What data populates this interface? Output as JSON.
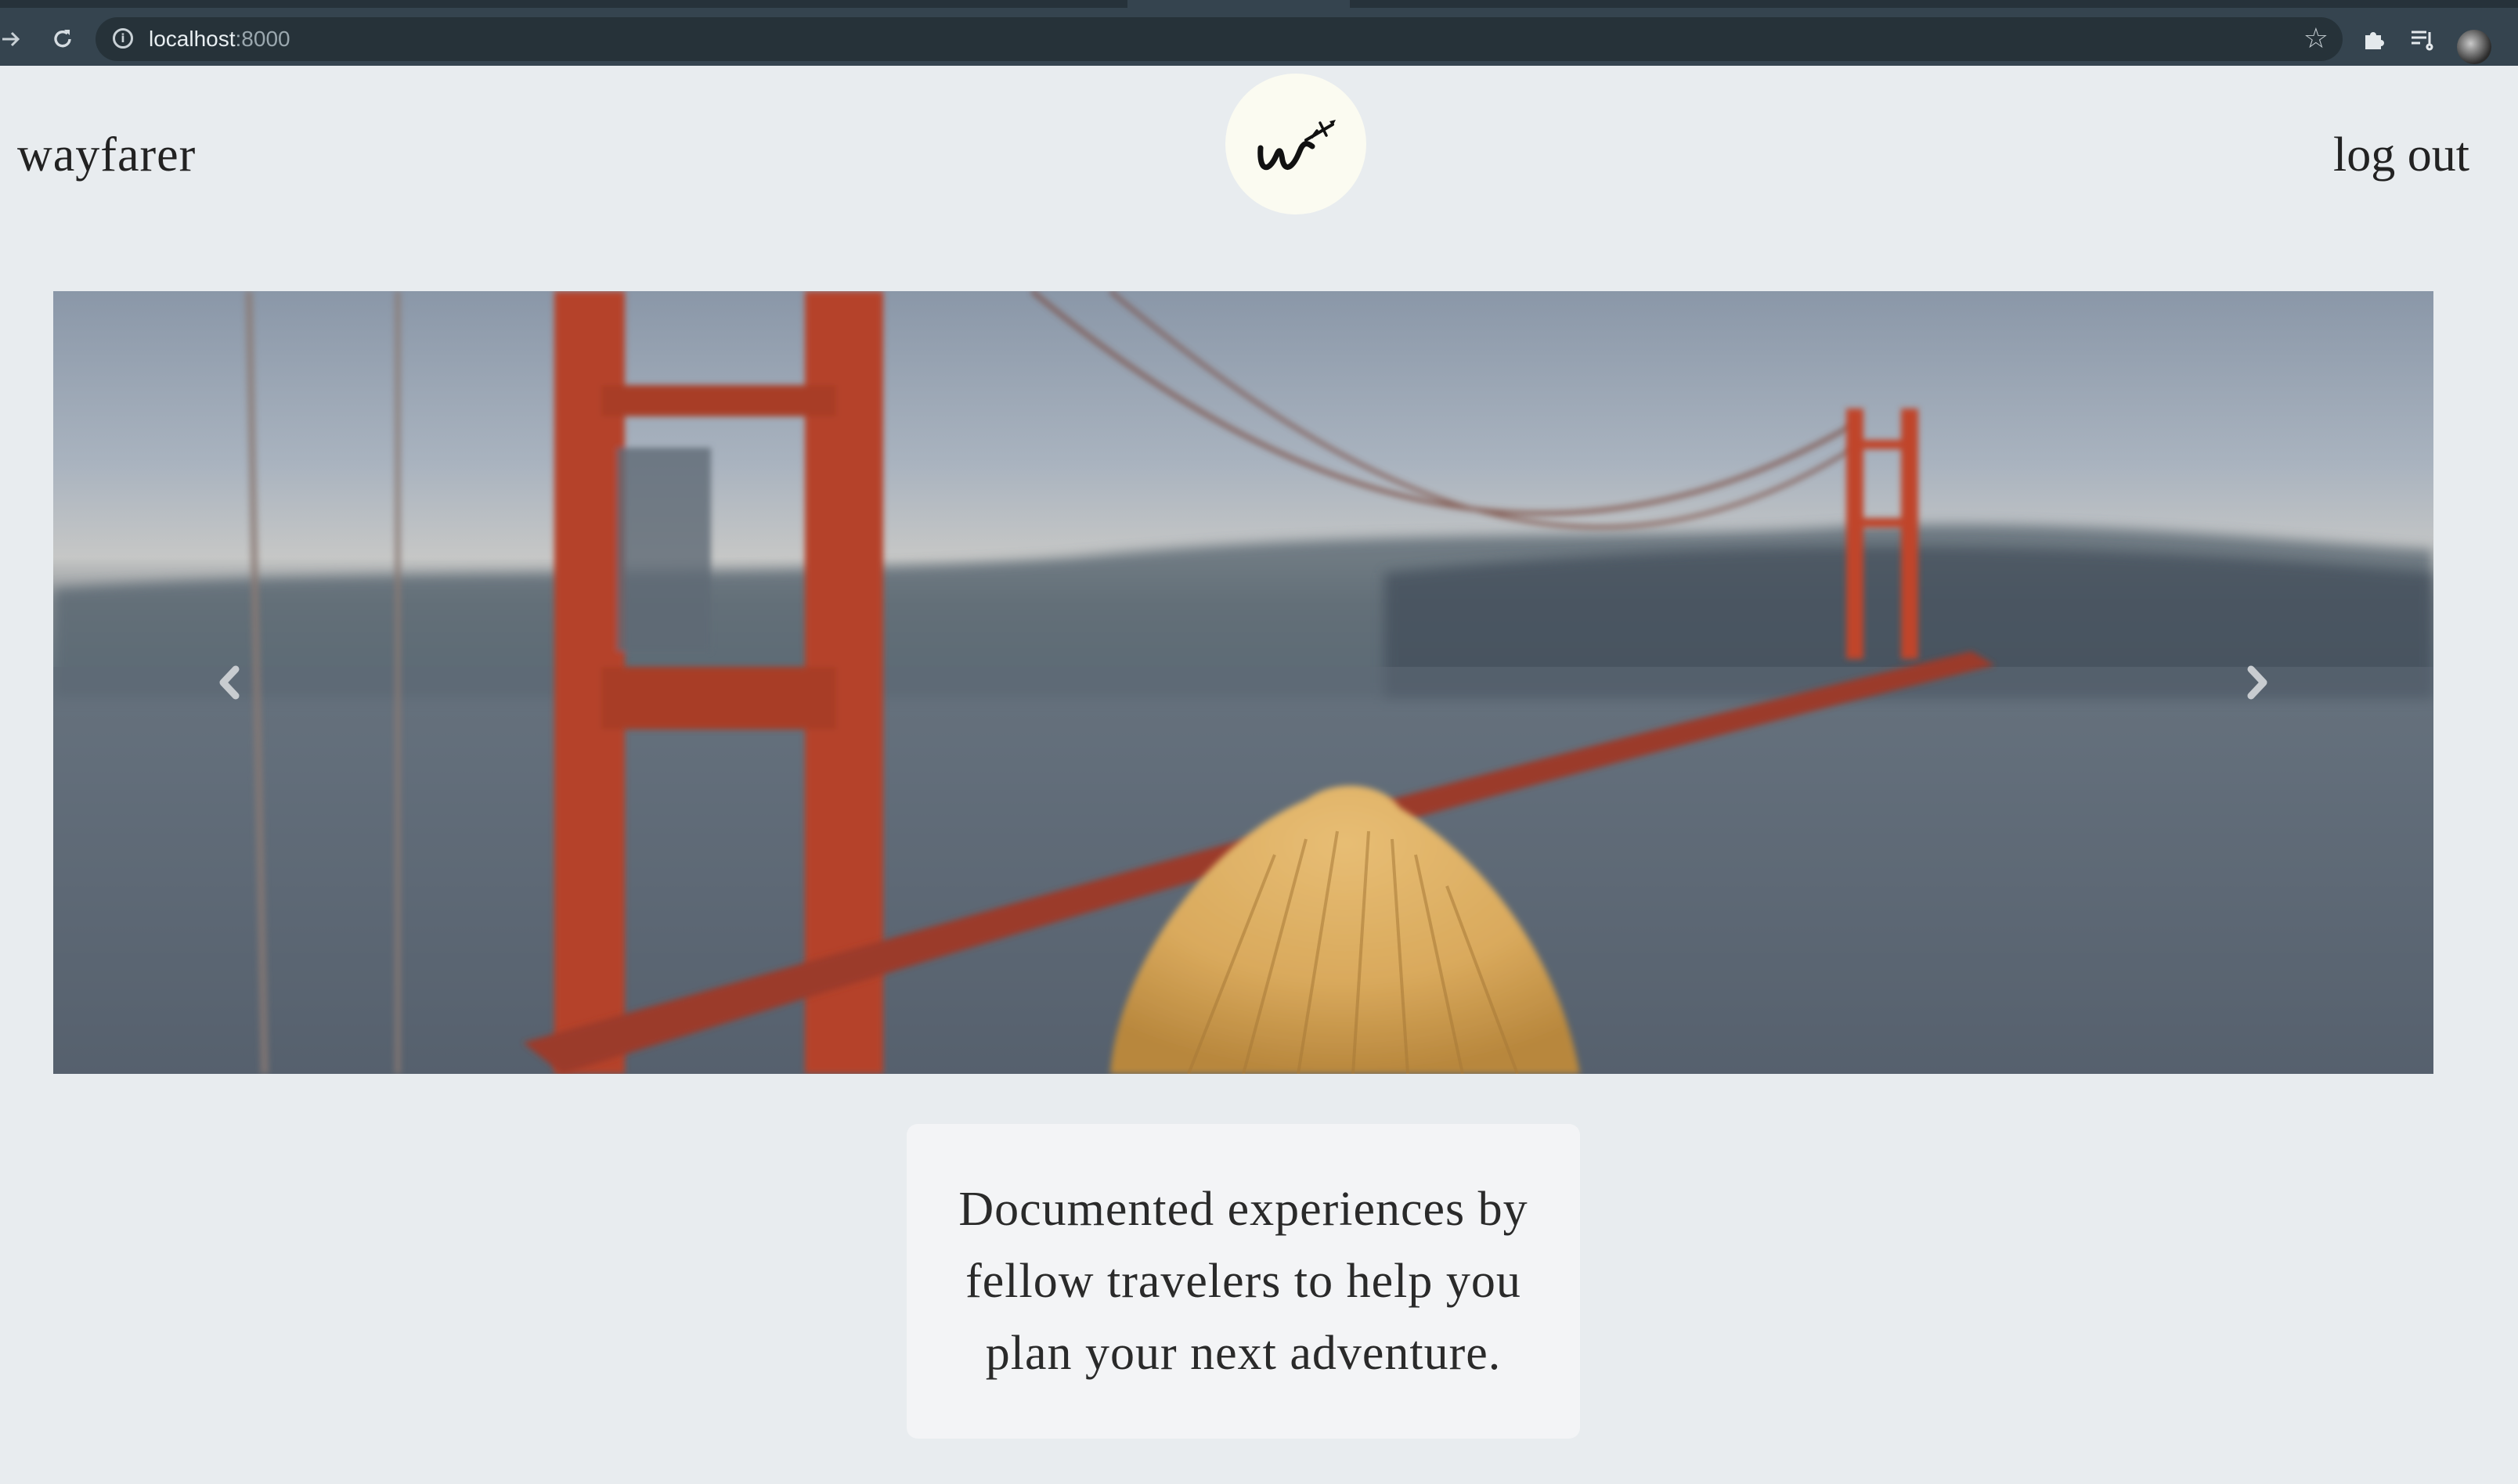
{
  "browser": {
    "url_host": "localhost",
    "url_port": ":8000"
  },
  "header": {
    "brand": "wayfarer",
    "logout_label": "log out"
  },
  "carousel": {
    "image_alt": "Person in a knit beanie looking at the Golden Gate Bridge"
  },
  "tagline": "Documented experiences by fellow travelers to help you plan your next adventure.",
  "colors": {
    "page_bg": "#e8ecef",
    "chrome_bg": "#35444f",
    "card_bg": "#f3f4f6",
    "bridge_red": "#b5432c",
    "beanie": "#d9a95c"
  }
}
